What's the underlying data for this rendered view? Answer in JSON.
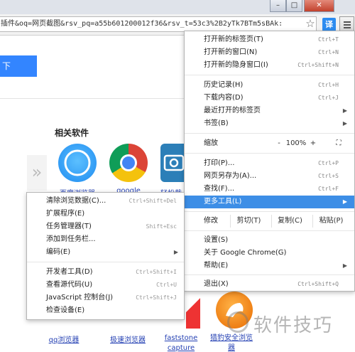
{
  "window": {
    "minimize": "–",
    "restore": "□",
    "close": "✕"
  },
  "address": {
    "url": "插件&oq=网页截图&rsv_pq=a55b601200012f36&rsv_t=53c3%2B2yTk7BTm5sBAk:"
  },
  "toolbar": {
    "star_icon": "star-icon",
    "extension_label": "译",
    "menu_icon": "hamburger-menu-icon"
  },
  "page": {
    "button_label": "下",
    "related_title": "相关软件",
    "prev_arrow": "»",
    "apps": [
      {
        "label": "百度浏览器",
        "color": "#1e8bf0"
      },
      {
        "label": "google",
        "color": "#db4437"
      },
      {
        "label": "轻松截",
        "color": "#2c7fb8"
      }
    ],
    "bottom_apps": [
      {
        "label": "qq浏览器"
      },
      {
        "label": "极速浏览器"
      },
      {
        "label": "faststone capture"
      },
      {
        "label": "猎豹安全浏览器"
      }
    ]
  },
  "menu": {
    "new_tab": {
      "label": "打开新的标签页(T)",
      "shortcut": "Ctrl+T"
    },
    "new_window": {
      "label": "打开新的窗口(N)",
      "shortcut": "Ctrl+N"
    },
    "new_incognito": {
      "label": "打开新的隐身窗口(I)",
      "shortcut": "Ctrl+Shift+N"
    },
    "history": {
      "label": "历史记录(H)",
      "shortcut": "Ctrl+H"
    },
    "downloads": {
      "label": "下载内容(D)",
      "shortcut": "Ctrl+J"
    },
    "recent_tabs": {
      "label": "最近打开的标签页"
    },
    "bookmarks": {
      "label": "书签(B)"
    },
    "zoom": {
      "label": "缩放",
      "minus": "-",
      "value": "100%",
      "plus": "+",
      "fullscreen": "⛶"
    },
    "print": {
      "label": "打印(P)...",
      "shortcut": "Ctrl+P"
    },
    "save_as": {
      "label": "网页另存为(A)...",
      "shortcut": "Ctrl+S"
    },
    "find": {
      "label": "查找(F)...",
      "shortcut": "Ctrl+F"
    },
    "more_tools": {
      "label": "更多工具(L)"
    },
    "edit": {
      "label": "修改",
      "cut": "剪切(T)",
      "copy": "复制(C)",
      "paste": "粘贴(P)"
    },
    "settings": {
      "label": "设置(S)"
    },
    "about": {
      "label": "关于 Google Chrome(G)"
    },
    "help": {
      "label": "帮助(E)"
    },
    "exit": {
      "label": "退出(X)",
      "shortcut": "Ctrl+Shift+Q"
    }
  },
  "submenu": {
    "clear_data": {
      "label": "清除浏览数据(C)...",
      "shortcut": "Ctrl+Shift+Del"
    },
    "extensions": {
      "label": "扩展程序(E)"
    },
    "task_manager": {
      "label": "任务管理器(T)",
      "shortcut": "Shift+Esc"
    },
    "add_taskbar": {
      "label": "添加到任务栏..."
    },
    "encoding": {
      "label": "编码(E)"
    },
    "dev_tools": {
      "label": "开发者工具(D)",
      "shortcut": "Ctrl+Shift+I"
    },
    "view_source": {
      "label": "查看源代码(U)",
      "shortcut": "Ctrl+U"
    },
    "js_console": {
      "label": "JavaScript 控制台(J)",
      "shortcut": "Ctrl+Shift+J"
    },
    "inspect": {
      "label": "检查设备(E)"
    }
  },
  "watermark": "软件技巧"
}
